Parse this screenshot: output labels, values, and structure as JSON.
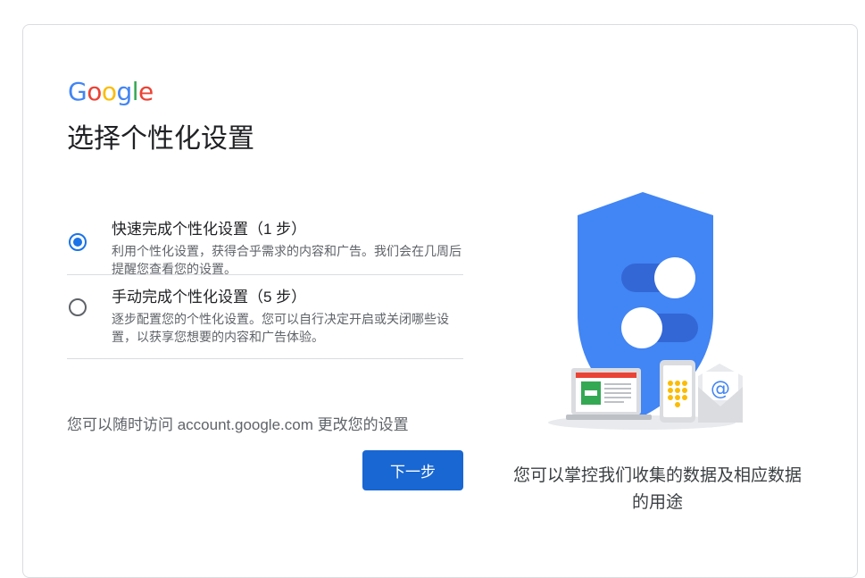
{
  "logo_text": "Google",
  "title": "选择个性化设置",
  "options": [
    {
      "title": "快速完成个性化设置（1 步）",
      "description": "利用个性化设置，获得合乎需求的内容和广告。我们会在几周后提醒您查看您的设置。",
      "selected": true
    },
    {
      "title": "手动完成个性化设置（5 步）",
      "description": "逐步配置您的个性化设置。您可以自行决定开启或关闭哪些设置，以获享您想要的内容和广告体验。",
      "selected": false
    }
  ],
  "footnote": "您可以随时访问 account.google.com 更改您的设置",
  "next_button": "下一步",
  "caption": "您可以掌控我们收集的数据及相应数据的用途",
  "colors": {
    "primary_blue": "#1967d2",
    "radio_blue": "#1a73e8",
    "shield_blue": "#4285f4"
  },
  "icons": {
    "shield": "shield-privacy-illustration",
    "email": "at-sign-icon"
  }
}
